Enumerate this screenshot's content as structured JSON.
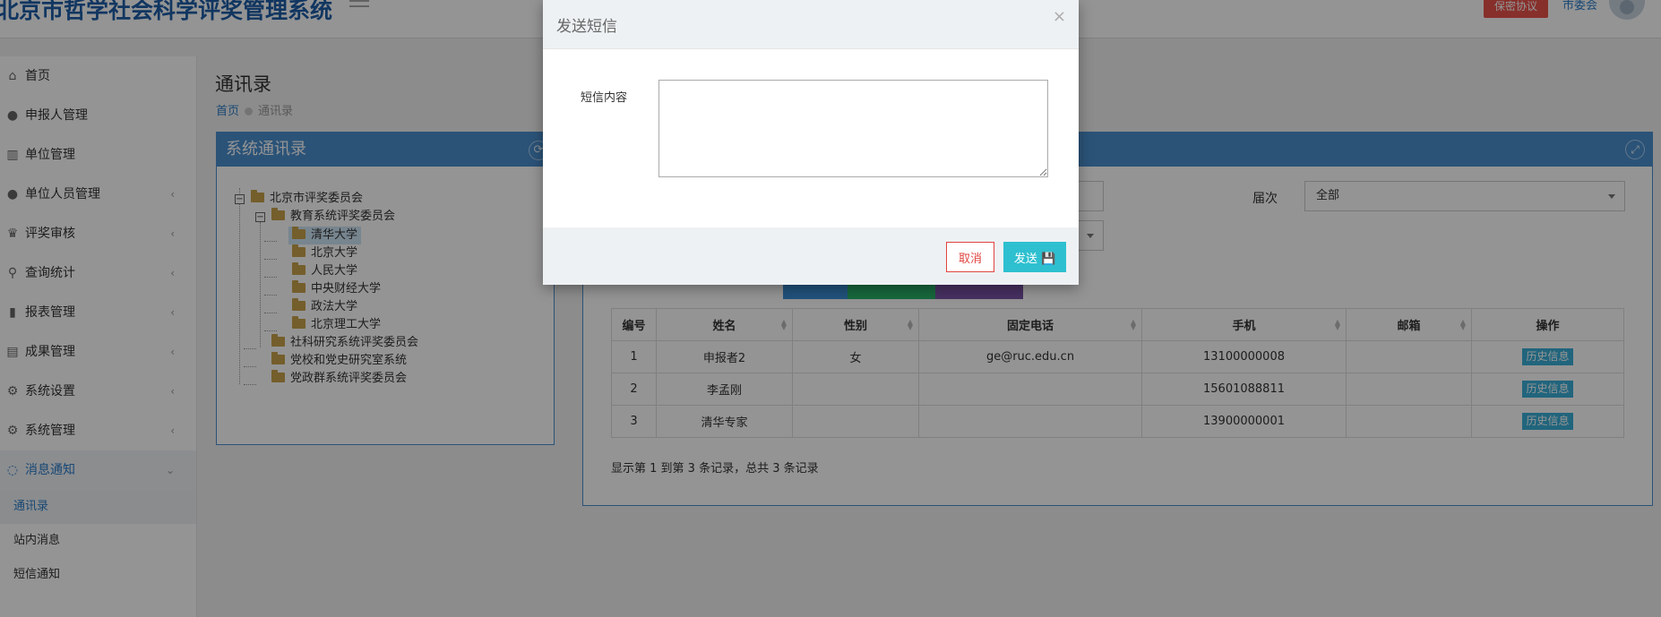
{
  "header": {
    "app_title": "北京市哲学社会科学评奖管理系统",
    "secret_btn": "保密协议",
    "user_name": "市委会"
  },
  "sidebar": {
    "items": [
      {
        "label": "首页",
        "icon": "home-icon",
        "glyph": "⌂",
        "chev": ""
      },
      {
        "label": "申报人管理",
        "icon": "user-icon",
        "glyph": "●",
        "chev": ""
      },
      {
        "label": "单位管理",
        "icon": "bank-icon",
        "glyph": "▥",
        "chev": ""
      },
      {
        "label": "单位人员管理",
        "icon": "users-icon",
        "glyph": "●",
        "chev": "‹"
      },
      {
        "label": "评奖审核",
        "icon": "trophy-icon",
        "glyph": "♛",
        "chev": "‹"
      },
      {
        "label": "查询统计",
        "icon": "search-icon",
        "glyph": "⚲",
        "chev": "‹"
      },
      {
        "label": "报表管理",
        "icon": "bar-chart-icon",
        "glyph": "▮",
        "chev": "‹"
      },
      {
        "label": "成果管理",
        "icon": "book-icon",
        "glyph": "▤",
        "chev": "‹"
      },
      {
        "label": "系统设置",
        "icon": "cogs-icon",
        "glyph": "⚙",
        "chev": "‹"
      },
      {
        "label": "系统管理",
        "icon": "gear-icon",
        "glyph": "⚙",
        "chev": "‹"
      },
      {
        "label": "消息通知",
        "icon": "comment-icon",
        "glyph": "◌",
        "chev": "⌄"
      }
    ],
    "sub_items": [
      {
        "label": "通讯录"
      },
      {
        "label": "站内消息"
      },
      {
        "label": "短信通知"
      }
    ]
  },
  "page": {
    "title": "通讯录",
    "breadcrumb_home": "首页",
    "breadcrumb_current": "通讯录"
  },
  "left_panel": {
    "title": "系统通讯录",
    "tree": [
      {
        "label": "北京市评奖委员会"
      },
      {
        "label": "教育系统评奖委员会"
      },
      {
        "label": "清华大学"
      },
      {
        "label": "北京大学"
      },
      {
        "label": "人民大学"
      },
      {
        "label": "中央财经大学"
      },
      {
        "label": "政法大学"
      },
      {
        "label": "北京理工大学"
      },
      {
        "label": "社科研究系统评奖委员会"
      },
      {
        "label": "党校和党史研究室系统"
      },
      {
        "label": "党政群系统评奖委员会"
      }
    ]
  },
  "filters": {
    "session_label": "届次",
    "session_value": "全部"
  },
  "table": {
    "headers": [
      "编号",
      "姓名",
      "性别",
      "固定电话",
      "手机",
      "邮箱",
      "操作"
    ],
    "rows": [
      {
        "no": "1",
        "name": "申报者2",
        "gender": "女",
        "phone": "ge@ruc.edu.cn",
        "mobile": "13100000008",
        "email": "",
        "action": "历史信息"
      },
      {
        "no": "2",
        "name": "李孟刚",
        "gender": "",
        "phone": "",
        "mobile": "15601088811",
        "email": "",
        "action": "历史信息"
      },
      {
        "no": "3",
        "name": "清华专家",
        "gender": "",
        "phone": "",
        "mobile": "13900000001",
        "email": "",
        "action": "历史信息"
      }
    ],
    "summary": "显示第 1 到第 3 条记录，总共 3 条记录"
  },
  "modal": {
    "title": "发送短信",
    "close": "×",
    "label": "短信内容",
    "textarea_value": "",
    "cancel": "取消",
    "send": "发送 💾"
  },
  "colors": {
    "brand": "#1e5ea8",
    "panel": "#4a90cf",
    "danger": "#e0443e",
    "send": "#2ec0d0",
    "history": "#3aaed8"
  }
}
